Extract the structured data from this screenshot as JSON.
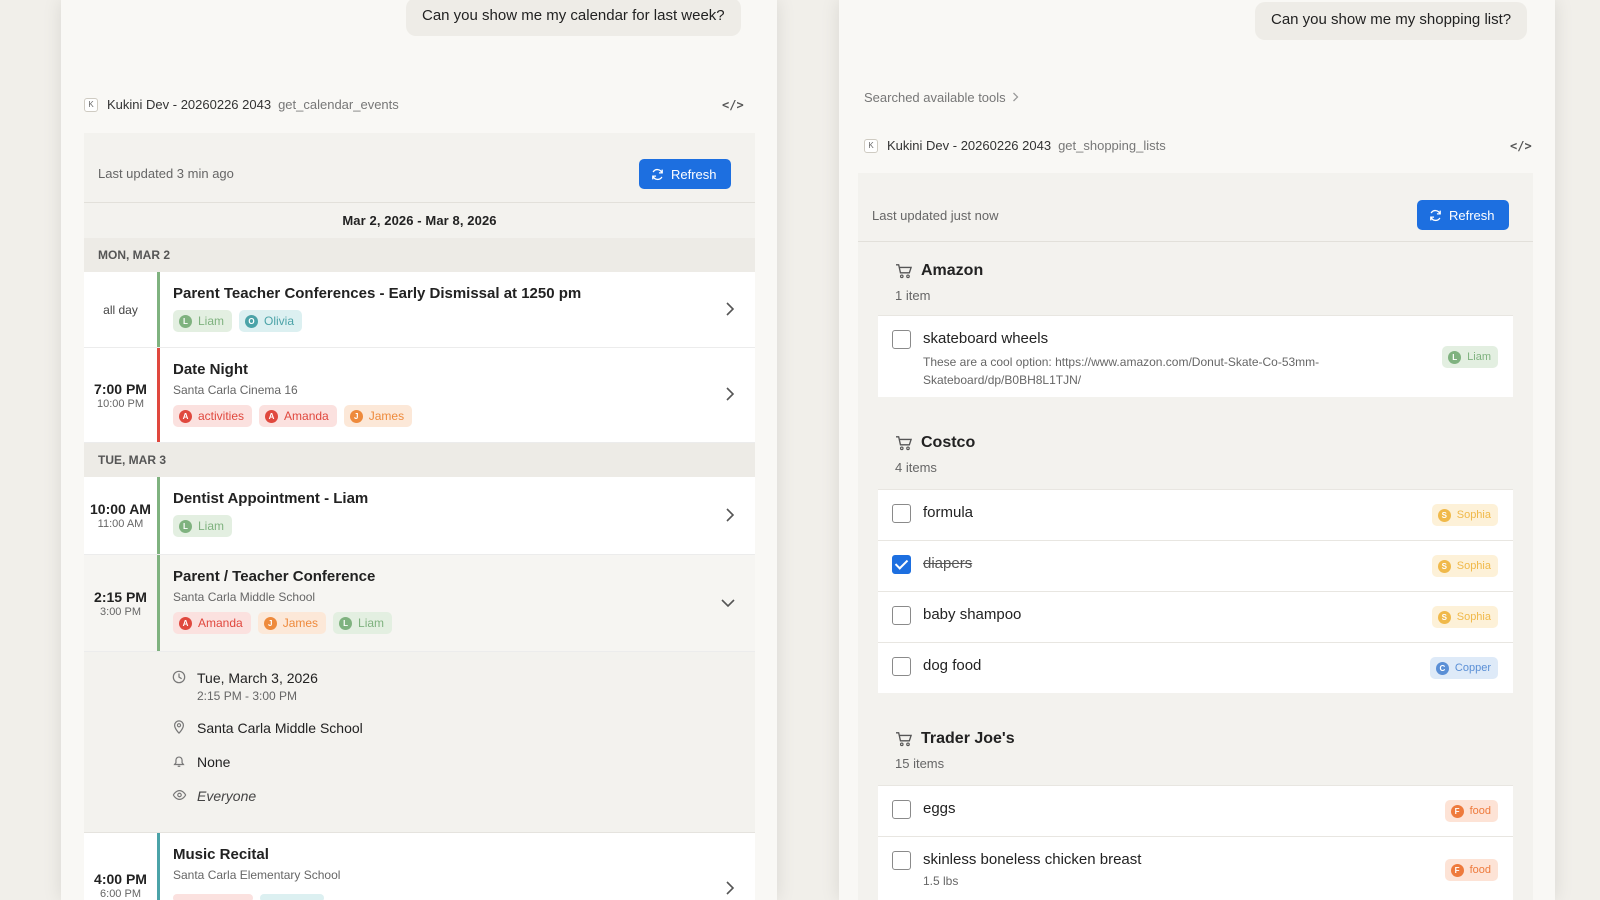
{
  "left": {
    "user_message": "Can you show me my calendar for last week?",
    "tool": {
      "k": "K",
      "server": "Kukini Dev - 20260226 2043",
      "name": "get_calendar_events",
      "code_icon": "</>"
    },
    "updated": "Last updated 3 min ago",
    "refresh_label": "Refresh",
    "date_range": "Mar 2, 2026 - Mar 8, 2026",
    "days": [
      {
        "header": "MON, MAR 2"
      },
      {
        "header": "TUE, MAR 3"
      }
    ],
    "events": [
      {
        "time_main": "all day",
        "title": "Parent Teacher Conferences - Early Dismissal at 1250 pm",
        "tags": [
          {
            "initial": "L",
            "label": "Liam"
          },
          {
            "initial": "O",
            "label": "Olivia"
          }
        ]
      },
      {
        "time_main": "7:00 PM",
        "time_end": "10:00 PM",
        "title": "Date Night",
        "location": "Santa Carla Cinema 16",
        "tags": [
          {
            "initial": "A",
            "label": "activities"
          },
          {
            "initial": "A",
            "label": "Amanda"
          },
          {
            "initial": "J",
            "label": "James"
          }
        ]
      },
      {
        "time_main": "10:00 AM",
        "time_end": "11:00 AM",
        "title": "Dentist Appointment - Liam",
        "tags": [
          {
            "initial": "L",
            "label": "Liam"
          }
        ]
      },
      {
        "time_main": "2:15 PM",
        "time_end": "3:00 PM",
        "title": "Parent / Teacher Conference",
        "location": "Santa Carla Middle School",
        "tags": [
          {
            "initial": "A",
            "label": "Amanda"
          },
          {
            "initial": "J",
            "label": "James"
          },
          {
            "initial": "L",
            "label": "Liam"
          }
        ]
      },
      {
        "time_main": "4:00 PM",
        "time_end": "6:00 PM",
        "title": "Music Recital",
        "location": "Santa Carla Elementary School"
      }
    ],
    "details": {
      "date": "Tue, March 3, 2026",
      "time": "2:15 PM - 3:00 PM",
      "location": "Santa Carla Middle School",
      "reminder": "None",
      "visibility": "Everyone"
    }
  },
  "right": {
    "user_message": "Can you show me my shopping list?",
    "searched": "Searched available tools",
    "tool": {
      "k": "K",
      "server": "Kukini Dev - 20260226 2043",
      "name": "get_shopping_lists",
      "code_icon": "</>"
    },
    "updated": "Last updated just now",
    "refresh_label": "Refresh",
    "lists": [
      {
        "name": "Amazon",
        "count": "1 item",
        "items": [
          {
            "name": "skateboard wheels",
            "desc": "These are a cool option: https://www.amazon.com/Donut-Skate-Co-53mm-Skateboard/dp/B0BH8L1TJN/",
            "tag_initial": "L",
            "tag": "Liam",
            "checked": false
          }
        ]
      },
      {
        "name": "Costco",
        "count": "4 items",
        "items": [
          {
            "name": "formula",
            "tag_initial": "S",
            "tag": "Sophia",
            "checked": false
          },
          {
            "name": "diapers",
            "tag_initial": "S",
            "tag": "Sophia",
            "checked": true
          },
          {
            "name": "baby shampoo",
            "tag_initial": "S",
            "tag": "Sophia",
            "checked": false
          },
          {
            "name": "dog food",
            "tag_initial": "C",
            "tag": "Copper",
            "checked": false
          }
        ]
      },
      {
        "name": "Trader Joe's",
        "count": "15 items",
        "items": [
          {
            "name": "eggs",
            "tag_initial": "F",
            "tag": "food",
            "checked": false
          },
          {
            "name": "skinless boneless chicken breast",
            "qty": "1.5 lbs",
            "tag_initial": "F",
            "tag": "food",
            "checked": false
          }
        ]
      }
    ]
  },
  "colors": {
    "accent": "#1d6fe0",
    "liam": "#7fb27f",
    "olivia": "#4ba3a8",
    "activities": "#e0483e",
    "amanda": "#e0483e",
    "james": "#ee8a3c",
    "sophia": "#f0b94a",
    "copper": "#5a8fd6",
    "food": "#ee7a3c"
  }
}
